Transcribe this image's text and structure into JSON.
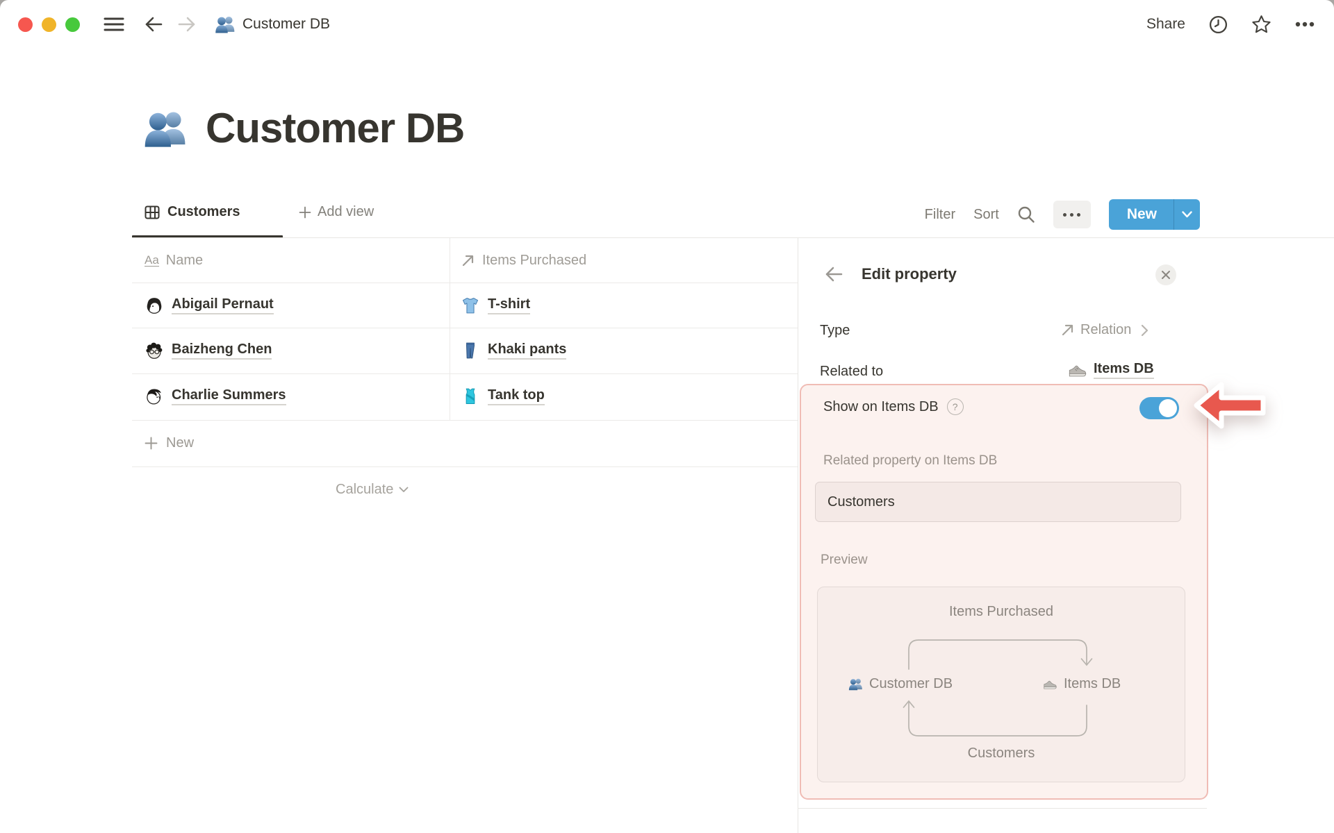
{
  "topbar": {
    "doc_title": "Customer DB",
    "share_label": "Share"
  },
  "page_title": "Customer DB",
  "view_tabs": {
    "active_tab": "Customers",
    "add_view_label": "Add view"
  },
  "toolbar": {
    "filter_label": "Filter",
    "sort_label": "Sort",
    "new_label": "New"
  },
  "table": {
    "columns": {
      "name": "Name",
      "items": "Items Purchased"
    },
    "rows": [
      {
        "name": "Abigail Pernaut",
        "item": "T-shirt"
      },
      {
        "name": "Baizheng Chen",
        "item": "Khaki pants"
      },
      {
        "name": "Charlie Summers",
        "item": "Tank top"
      }
    ],
    "new_row_label": "New",
    "calculate_label": "Calculate"
  },
  "panel": {
    "title": "Edit property",
    "type_label": "Type",
    "type_value": "Relation",
    "related_label": "Related to",
    "related_value": "Items DB",
    "show_on_label": "Show on Items DB",
    "toggle_state": "on",
    "related_property_label": "Related property on Items DB",
    "related_property_value": "Customers",
    "preview_label": "Preview",
    "diagram": {
      "top_label": "Items Purchased",
      "left_node": "Customer DB",
      "right_node": "Items DB",
      "bottom_label": "Customers"
    }
  },
  "colors": {
    "accent_blue": "#4aa3d8",
    "highlight_bg": "#fcf2ef",
    "highlight_border": "#f0bcb5",
    "arrow_red": "#e8584e",
    "text_dark": "#37352f",
    "text_gray": "#9b9790"
  }
}
